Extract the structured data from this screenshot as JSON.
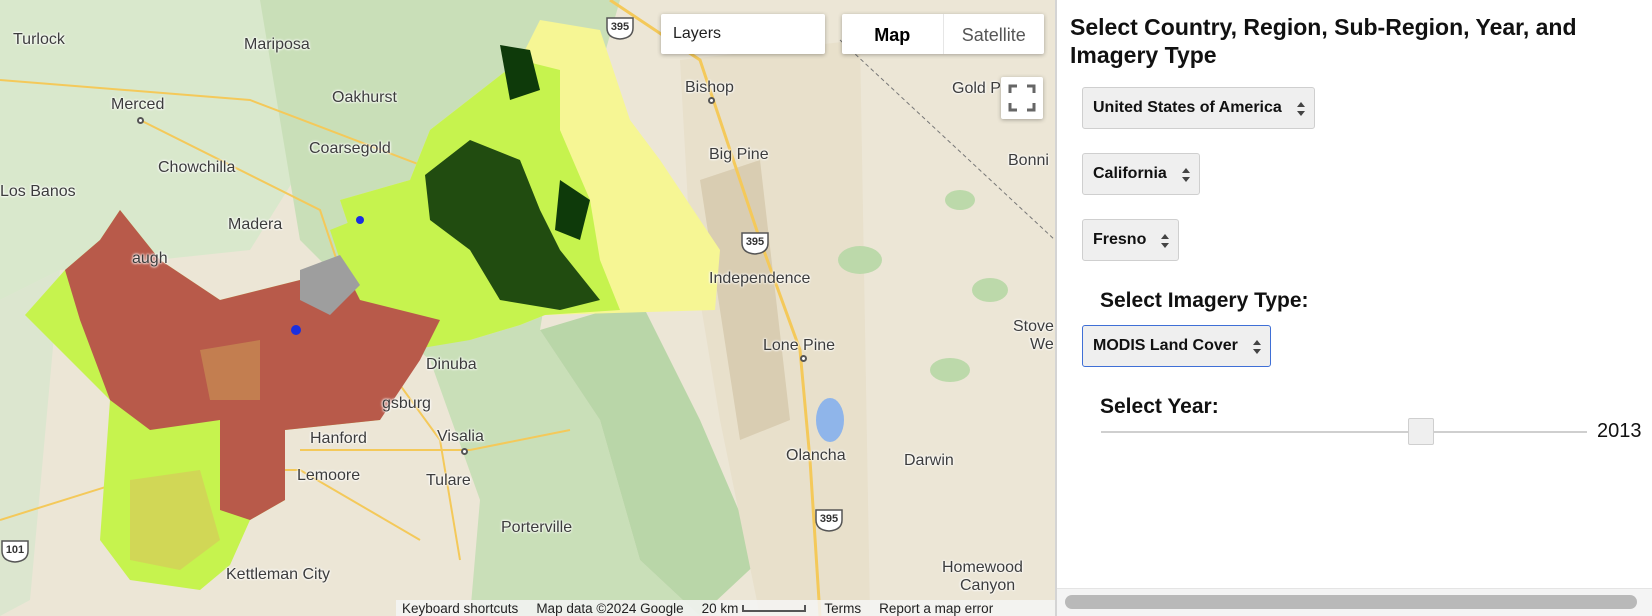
{
  "map": {
    "layers_label": "Layers",
    "map_type": {
      "map_label": "Map",
      "satellite_label": "Satellite"
    },
    "places": {
      "turlock": "Turlock",
      "mariposa": "Mariposa",
      "merced": "Merced",
      "oakhurst": "Oakhurst",
      "coarsegold": "Coarsegold",
      "chowchilla": "Chowchilla",
      "los_banos": "Los Banos",
      "madera": "Madera",
      "augh": "augh",
      "bishop": "Bishop",
      "gold_p": "Gold P",
      "big_pine": "Big Pine",
      "bonni": "Bonni",
      "independence": "Independence",
      "lone_pine": "Lone Pine",
      "stove": "Stove",
      "we": "We",
      "dinuba": "Dinuba",
      "gsburg": "gsburg",
      "hanford": "Hanford",
      "visalia": "Visalia",
      "olancha": "Olancha",
      "darwin": "Darwin",
      "lemoore": "Lemoore",
      "tulare": "Tulare",
      "porterville": "Porterville",
      "kettleman_city": "Kettleman City",
      "homewood": "Homewood",
      "canyon": "Canyon"
    },
    "shields": {
      "hwy395": "395",
      "hwy101": "101"
    },
    "attribution": {
      "keyboard": "Keyboard shortcuts",
      "mapdata": "Map data ©2024 Google",
      "scale": "20 km",
      "terms": "Terms",
      "report": "Report a map error"
    }
  },
  "panel": {
    "title": "Select Country, Region, Sub-Region, Year, and Imagery Type",
    "country": "United States of America",
    "region": "California",
    "subregion": "Fresno",
    "imagery_heading": "Select Imagery Type:",
    "imagery": "MODIS Land Cover",
    "year_heading": "Select Year:",
    "year": "2013"
  },
  "colors": {
    "croplands": "#b85a4a",
    "grassland": "#c6f34e",
    "forest": "#0e3a0a",
    "shrubland": "#f6f694",
    "savanna": "#d8c45c",
    "urban": "#9e9e9e",
    "water": "#1a2fe0"
  }
}
